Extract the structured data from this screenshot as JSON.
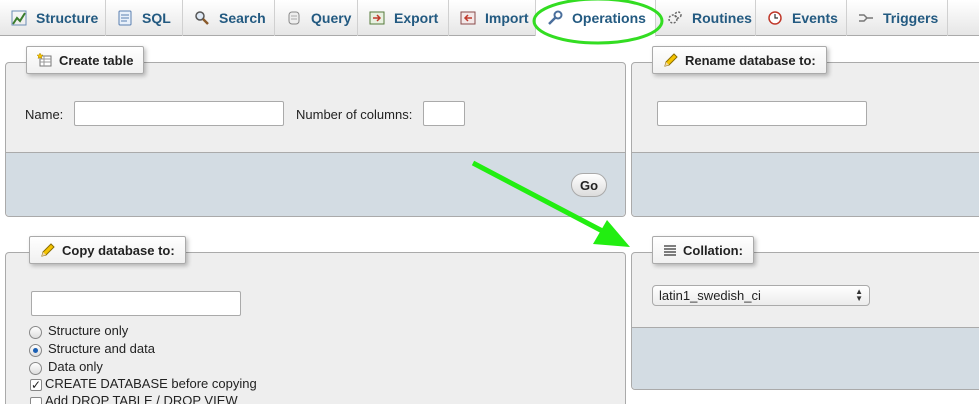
{
  "tabs": [
    {
      "label": "Structure",
      "icon": "structure-icon"
    },
    {
      "label": "SQL",
      "icon": "sql-icon"
    },
    {
      "label": "Search",
      "icon": "search-icon"
    },
    {
      "label": "Query",
      "icon": "query-icon"
    },
    {
      "label": "Export",
      "icon": "export-icon"
    },
    {
      "label": "Import",
      "icon": "import-icon"
    },
    {
      "label": "Operations",
      "icon": "wrench-icon",
      "active": true
    },
    {
      "label": "Routines",
      "icon": "routines-icon"
    },
    {
      "label": "Events",
      "icon": "events-icon"
    },
    {
      "label": "Triggers",
      "icon": "triggers-icon"
    }
  ],
  "create_table": {
    "legend": "Create table",
    "name_label": "Name:",
    "name_value": "",
    "columns_label": "Number of columns:",
    "columns_value": "",
    "go_label": "Go"
  },
  "rename_db": {
    "legend": "Rename database to:",
    "value": ""
  },
  "copy_db": {
    "legend": "Copy database to:",
    "value": "",
    "options": [
      {
        "label": "Structure only",
        "checked": false
      },
      {
        "label": "Structure and data",
        "checked": true
      },
      {
        "label": "Data only",
        "checked": false
      }
    ],
    "checkboxes": [
      {
        "label": "CREATE DATABASE before copying",
        "checked": true
      },
      {
        "label": "Add DROP TABLE / DROP VIEW",
        "checked": false
      }
    ]
  },
  "collation": {
    "legend": "Collation:",
    "selected": "latin1_swedish_ci"
  },
  "annotations": {
    "highlight_color": "#33dd22",
    "arrow_color": "#22ee11"
  },
  "colors": {
    "tab_text": "#235a81",
    "panel_bg": "#eeeeee",
    "footer_bg": "#d3dce3"
  }
}
